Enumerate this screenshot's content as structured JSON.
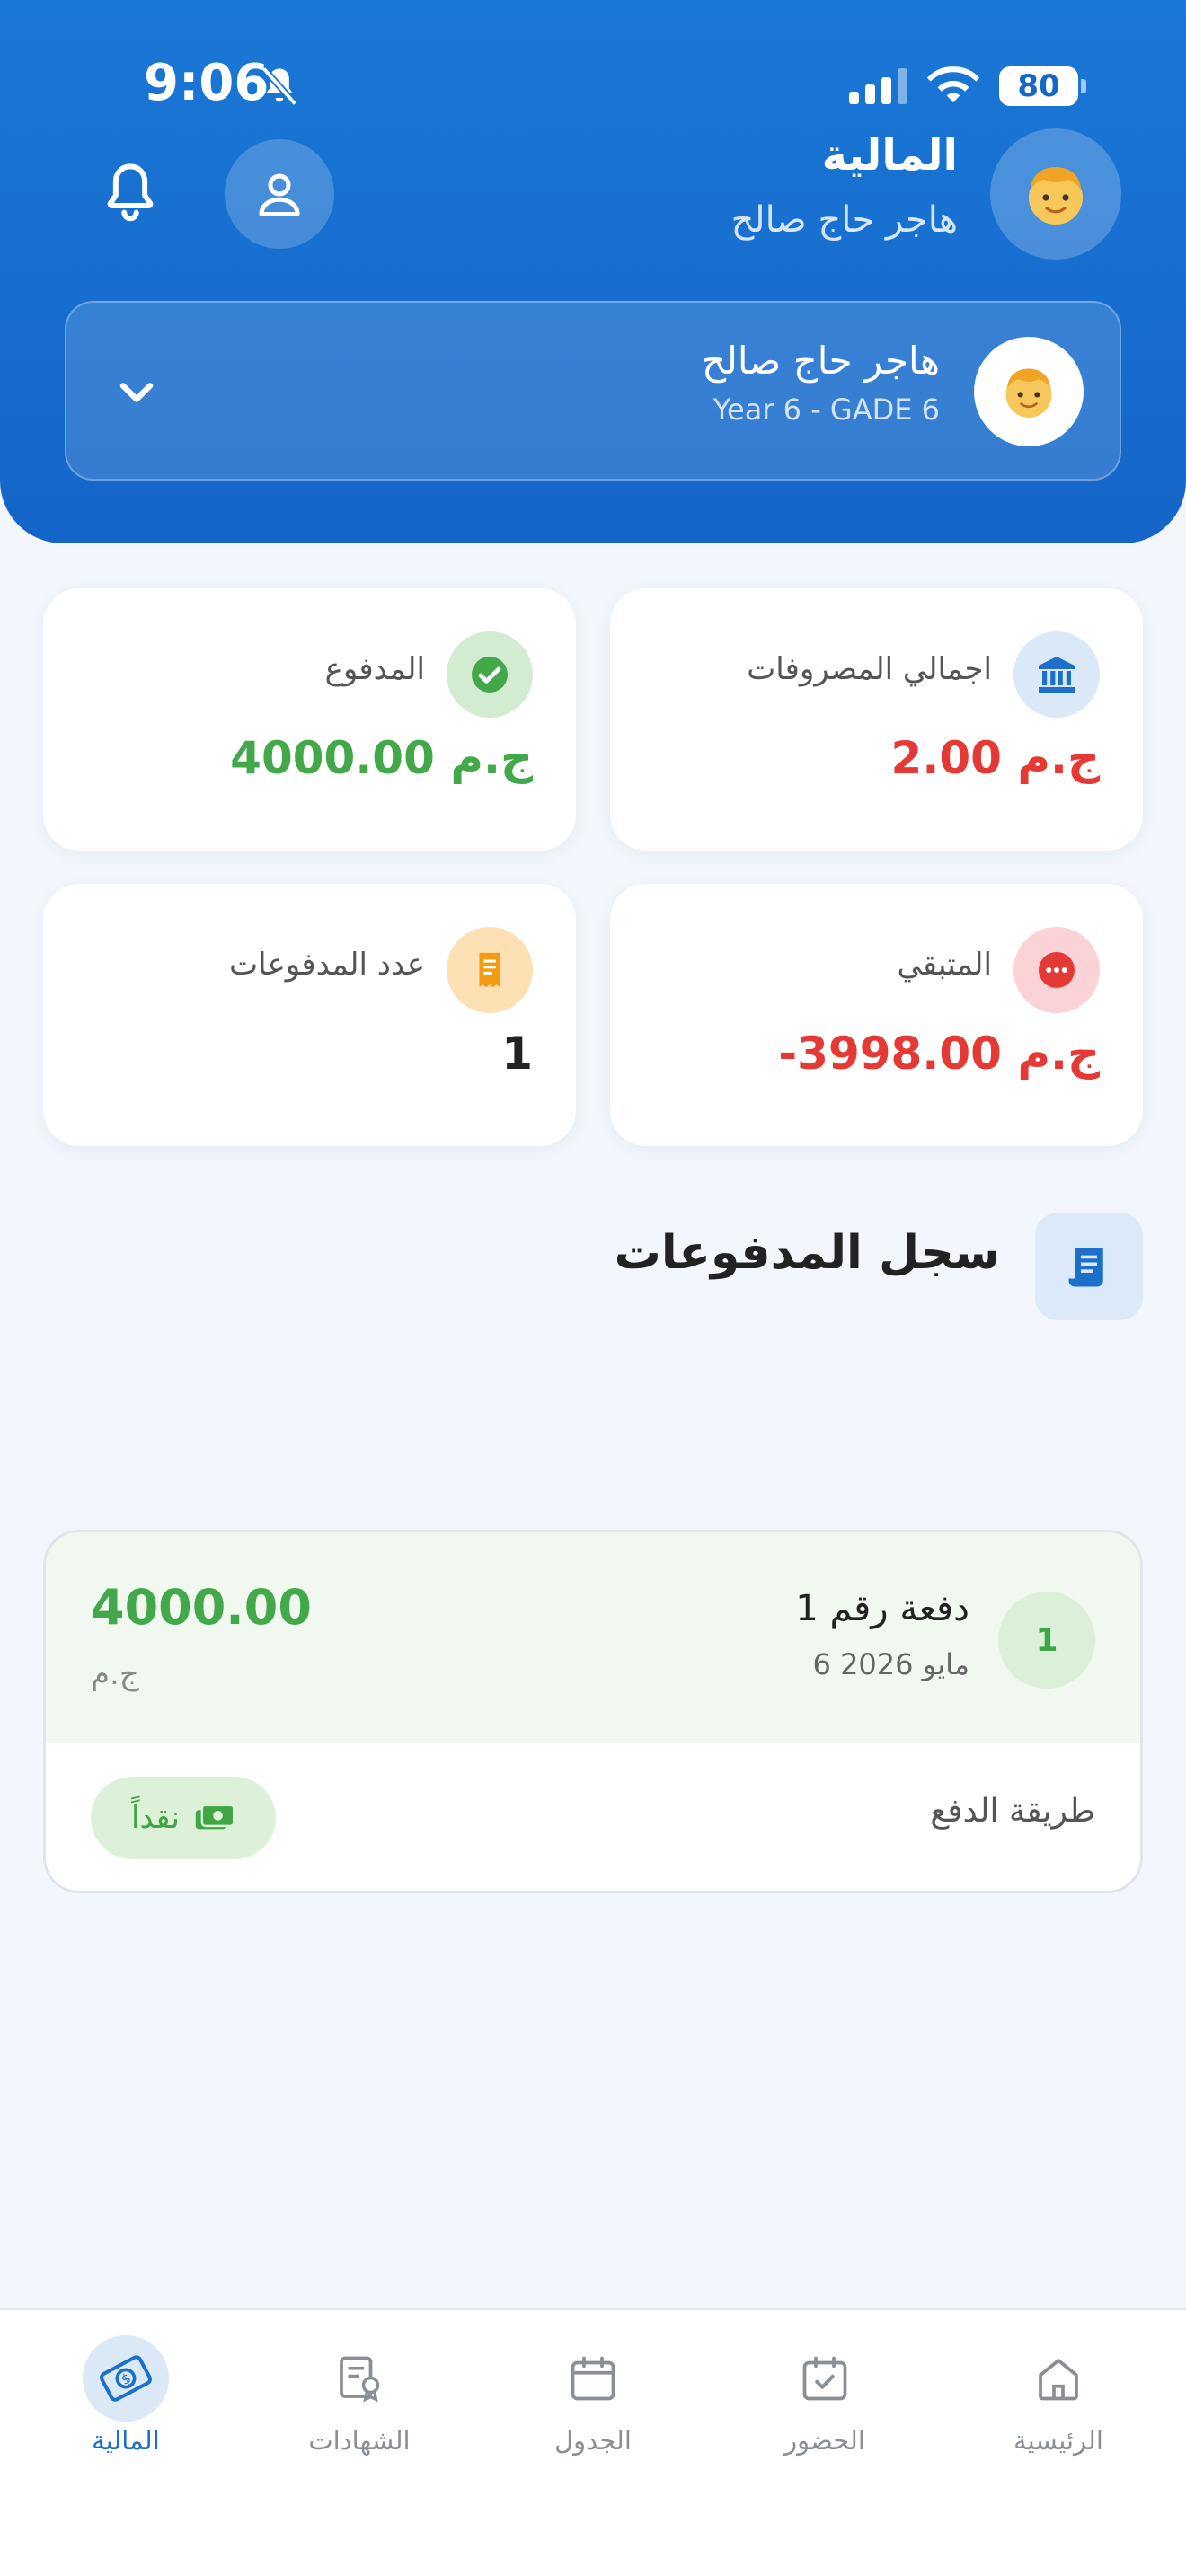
{
  "status_bar": {
    "time": "9:06",
    "battery": "80"
  },
  "header": {
    "title": "المالية",
    "subtitle": "هاجر حاج صالح"
  },
  "student_selector": {
    "name": "هاجر حاج صالح",
    "grade": "Year 6 - GADE 6"
  },
  "stats": {
    "total_expenses": {
      "label": "اجمالي المصروفات",
      "value": "2.00 ج.م",
      "color": "#e53935"
    },
    "paid": {
      "label": "المدفوع",
      "value": "4000.00 ج.م",
      "color": "#43a84a"
    },
    "remaining": {
      "label": "المتبقي",
      "value": "-3998.00 ج.م",
      "color": "#e53935"
    },
    "payments_count": {
      "label": "عدد المدفوعات",
      "value": "1",
      "color": "#222222"
    }
  },
  "payments_section": {
    "title": "سجل المدفوعات",
    "items": [
      {
        "number": "1",
        "title": "دفعة رقم 1",
        "date": "6 مايو 2026",
        "amount": "4000.00",
        "currency": "ج.م",
        "method_label": "طريقة الدفع",
        "method": "نقداً"
      }
    ]
  },
  "bottom_nav": {
    "items": [
      {
        "label": "المالية",
        "icon": "money-icon",
        "active": true
      },
      {
        "label": "الشهادات",
        "icon": "certificate-icon",
        "active": false
      },
      {
        "label": "الجدول",
        "icon": "calendar-icon",
        "active": false
      },
      {
        "label": "الحضور",
        "icon": "attendance-icon",
        "active": false
      },
      {
        "label": "الرئيسية",
        "icon": "home-icon",
        "active": false
      }
    ]
  },
  "colors": {
    "primary": "#1a72d2",
    "success": "#43a84a",
    "danger": "#e53935"
  }
}
